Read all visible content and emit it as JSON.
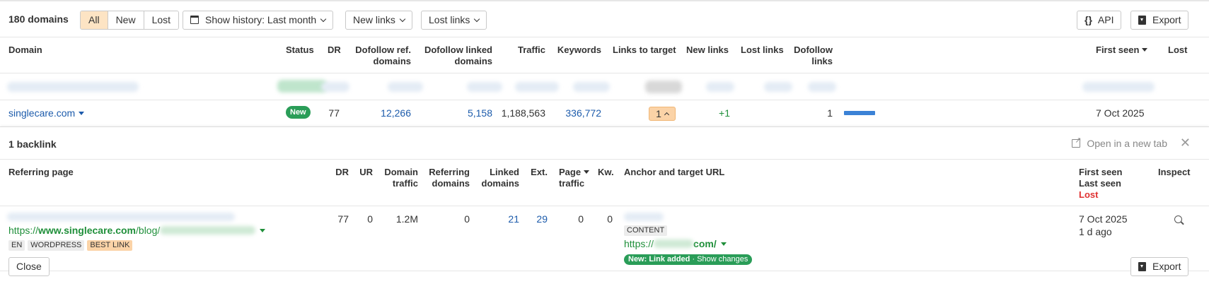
{
  "toolbar": {
    "domain_count": "180 domains",
    "filters": [
      "All",
      "New",
      "Lost"
    ],
    "active_filter": "All",
    "history_label": "Show history: Last month",
    "new_links_label": "New links",
    "lost_links_label": "Lost links",
    "api_icon": "{}",
    "api_label": "API",
    "export_label": "Export"
  },
  "domains_table": {
    "headers": {
      "domain": "Domain",
      "status": "Status",
      "dr": "DR",
      "dofollow_ref_1": "Dofollow ref.",
      "dofollow_ref_2": "domains",
      "dofollow_linked_1": "Dofollow linked",
      "dofollow_linked_2": "domains",
      "traffic": "Traffic",
      "keywords": "Keywords",
      "links_to_target": "Links to target",
      "new_links": "New links",
      "lost_links": "Lost links",
      "dofollow_links_1": "Dofollow",
      "dofollow_links_2": "links",
      "first_seen": "First seen",
      "lost": "Lost"
    },
    "row": {
      "domain": "singlecare.com",
      "status": "New",
      "dr": "77",
      "dofollow_ref_domains": "12,266",
      "dofollow_linked_domains": "5,158",
      "traffic": "1,188,563",
      "keywords": "336,772",
      "links_to_target": "1",
      "new_links": "+1",
      "dofollow_links": "1",
      "dofollow_links_fraction": 0.5,
      "first_seen": "7 Oct 2025"
    }
  },
  "backlinks_panel": {
    "title": "1 backlink",
    "open_new_tab": "Open in a new tab",
    "close_glyph": "✕",
    "headers": {
      "referring_page": "Referring page",
      "dr": "DR",
      "ur": "UR",
      "domain_traffic_1": "Domain",
      "domain_traffic_2": "traffic",
      "referring_domains_1": "Referring",
      "referring_domains_2": "domains",
      "linked_domains_1": "Linked",
      "linked_domains_2": "domains",
      "ext": "Ext.",
      "page_traffic_1": "Page",
      "page_traffic_2": "traffic",
      "kw": "Kw.",
      "anchor": "Anchor and target URL",
      "first_seen": "First seen",
      "last_seen": "Last seen",
      "lost": "Lost",
      "inspect": "Inspect"
    },
    "row": {
      "url_prefix": "https://",
      "url_domain": "www.singlecare.com",
      "url_path": "/blog/",
      "tags": [
        "EN",
        "WORDPRESS",
        "BEST LINK"
      ],
      "dr": "77",
      "ur": "0",
      "domain_traffic": "1.2M",
      "referring_domains": "0",
      "linked_domains": "21",
      "ext": "29",
      "page_traffic": "0",
      "kw": "0",
      "anchor_tag": "CONTENT",
      "target_prefix": "https://",
      "target_suffix": "com/",
      "change_status": "New: Link added",
      "change_sep": " · ",
      "change_link": "Show changes",
      "first_seen": "7 Oct 2025",
      "last_seen": "1 d ago"
    },
    "close_label": "Close",
    "export_label": "Export"
  }
}
